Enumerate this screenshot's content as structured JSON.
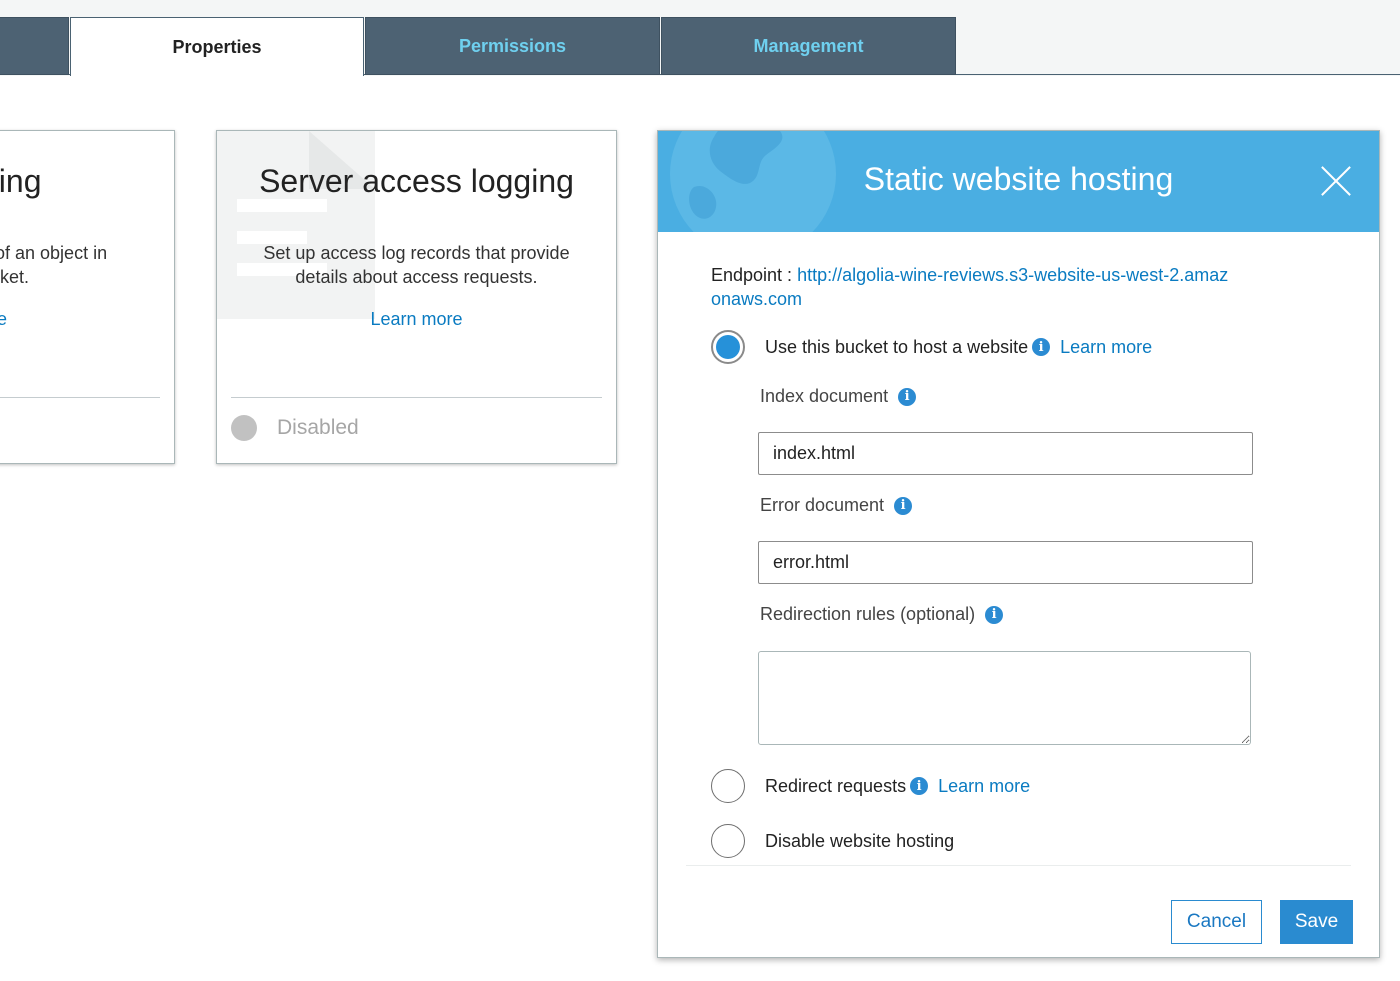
{
  "tabs": {
    "left_partial": "",
    "properties": "Properties",
    "permissions": "Permissions",
    "management": "Management"
  },
  "left_card": {
    "title": "ning",
    "desc": "s of an object in ucket.",
    "link": "ore"
  },
  "logging_card": {
    "title": "Server access logging",
    "desc": "Set up access log records that provide details about access requests.",
    "link": "Learn more",
    "status": "Disabled"
  },
  "modal": {
    "title": "Static website hosting",
    "endpoint_label": "Endpoint : ",
    "endpoint_url": "http://algolia-wine-reviews.s3-website-us-west-2.amazonaws.com",
    "option_host": "Use this bucket to host a website",
    "option_host_learn": "Learn more",
    "index_label": "Index document",
    "index_value": "index.html",
    "error_label": "Error document",
    "error_value": "error.html",
    "redirection_label": "Redirection rules (optional)",
    "redirection_value": "",
    "option_redirect": "Redirect requests",
    "option_redirect_learn": "Learn more",
    "option_disable": "Disable website hosting",
    "cancel": "Cancel",
    "save": "Save",
    "selected_option": "host"
  },
  "colors": {
    "header_blue": "#4aaee2",
    "tab_dark": "#4d6273",
    "tab_text": "#6fd0ef",
    "link": "#0a7bc1",
    "primary": "#2a8bd0"
  },
  "icons": {
    "info": "info-icon",
    "close": "close-icon",
    "globe": "globe-icon",
    "document": "document-icon"
  }
}
